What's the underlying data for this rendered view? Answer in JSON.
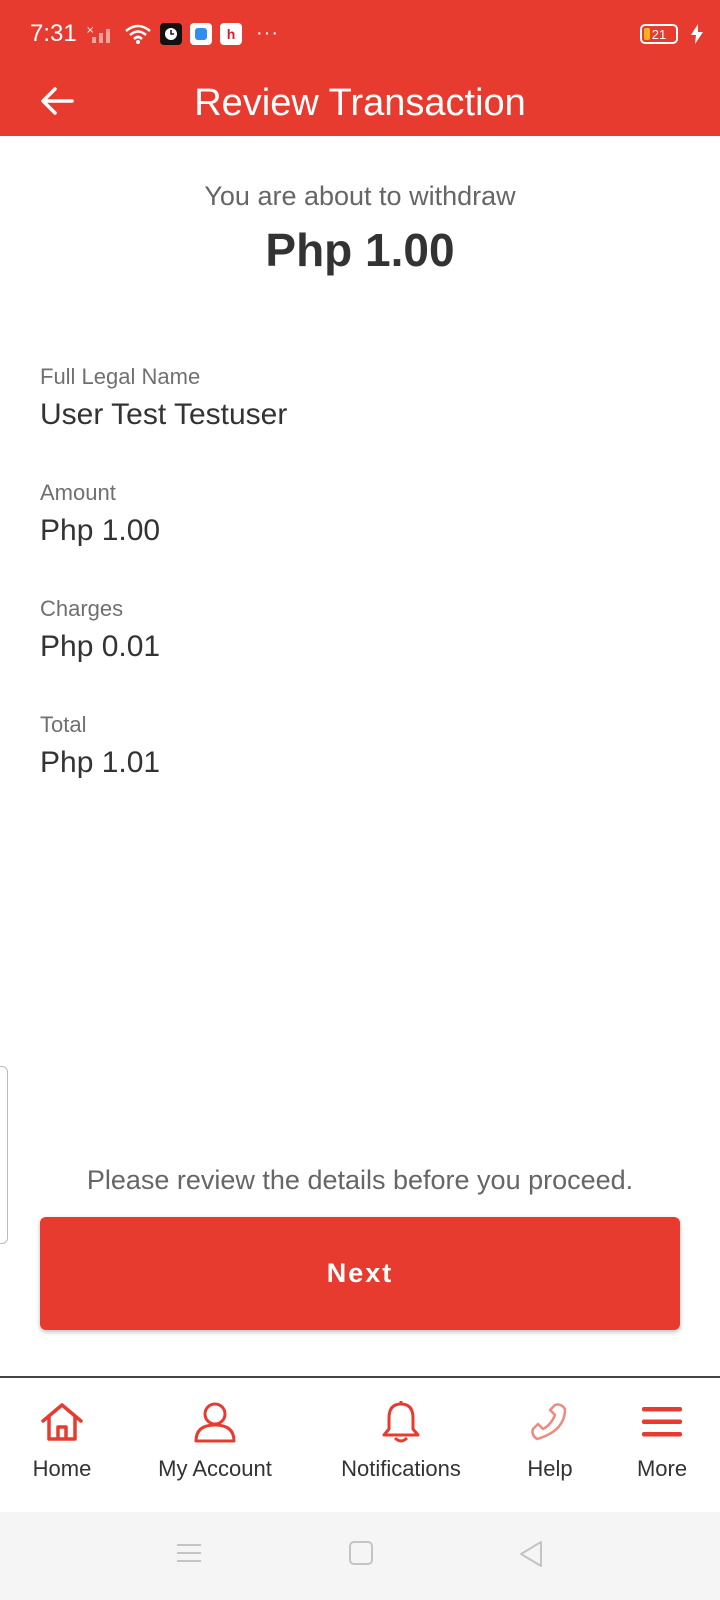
{
  "status_bar": {
    "time": "7:31",
    "battery": "21",
    "more_indicator": "···",
    "icons": [
      "signal-off-icon",
      "wifi-icon",
      "app-icon-clock",
      "app-icon-blue",
      "app-icon-h",
      "charging-bolt-icon"
    ]
  },
  "app_bar": {
    "title": "Review Transaction",
    "back_icon": "arrow-left-icon",
    "color": "#e63b2e"
  },
  "summary": {
    "intro": "You are about to withdraw",
    "amount": "Php 1.00"
  },
  "details": [
    {
      "label": "Full Legal Name",
      "value": "User Test Testuser"
    },
    {
      "label": "Amount",
      "value": "Php 1.00"
    },
    {
      "label": "Charges",
      "value": "Php 0.01"
    },
    {
      "label": "Total",
      "value": "Php 1.01"
    }
  ],
  "review_note": "Please review the details before you proceed.",
  "next_button": "Next",
  "bottom_nav": [
    {
      "label": "Home",
      "icon": "home-icon"
    },
    {
      "label": "My Account",
      "icon": "user-icon"
    },
    {
      "label": "Notifications",
      "icon": "bell-icon"
    },
    {
      "label": "Help",
      "icon": "phone-icon"
    },
    {
      "label": "More",
      "icon": "menu-icon"
    }
  ],
  "system_nav": [
    "recents-icon",
    "home-square-icon",
    "back-triangle-icon"
  ]
}
